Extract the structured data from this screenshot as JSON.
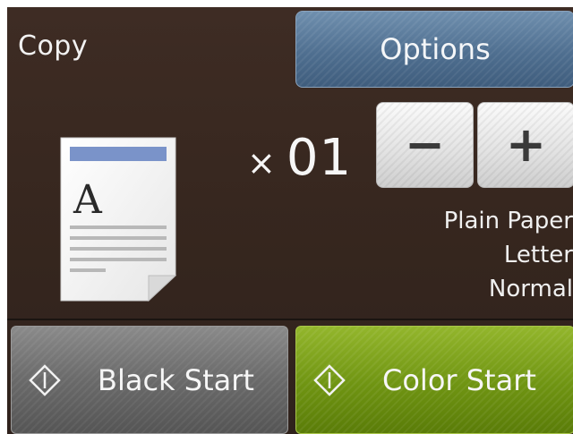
{
  "header": {
    "title": "Copy",
    "options_label": "Options"
  },
  "copies": {
    "multiplier_symbol": "×",
    "count": "01"
  },
  "stepper": {
    "decrement_label": "−",
    "increment_label": "+"
  },
  "settings": {
    "paper_type": "Plain Paper",
    "paper_size": "Letter",
    "quality": "Normal"
  },
  "document_preview": {
    "letter": "A"
  },
  "actions": {
    "black_start_label": "Black Start",
    "color_start_label": "Color Start"
  },
  "colors": {
    "background": "#3a2a22",
    "options_button": "#5a7a9a",
    "color_start_button": "#7a9e1a",
    "black_start_button": "#6a6a6a"
  },
  "icons": {
    "start": "start-diamond-icon",
    "document": "document-preview-icon"
  }
}
